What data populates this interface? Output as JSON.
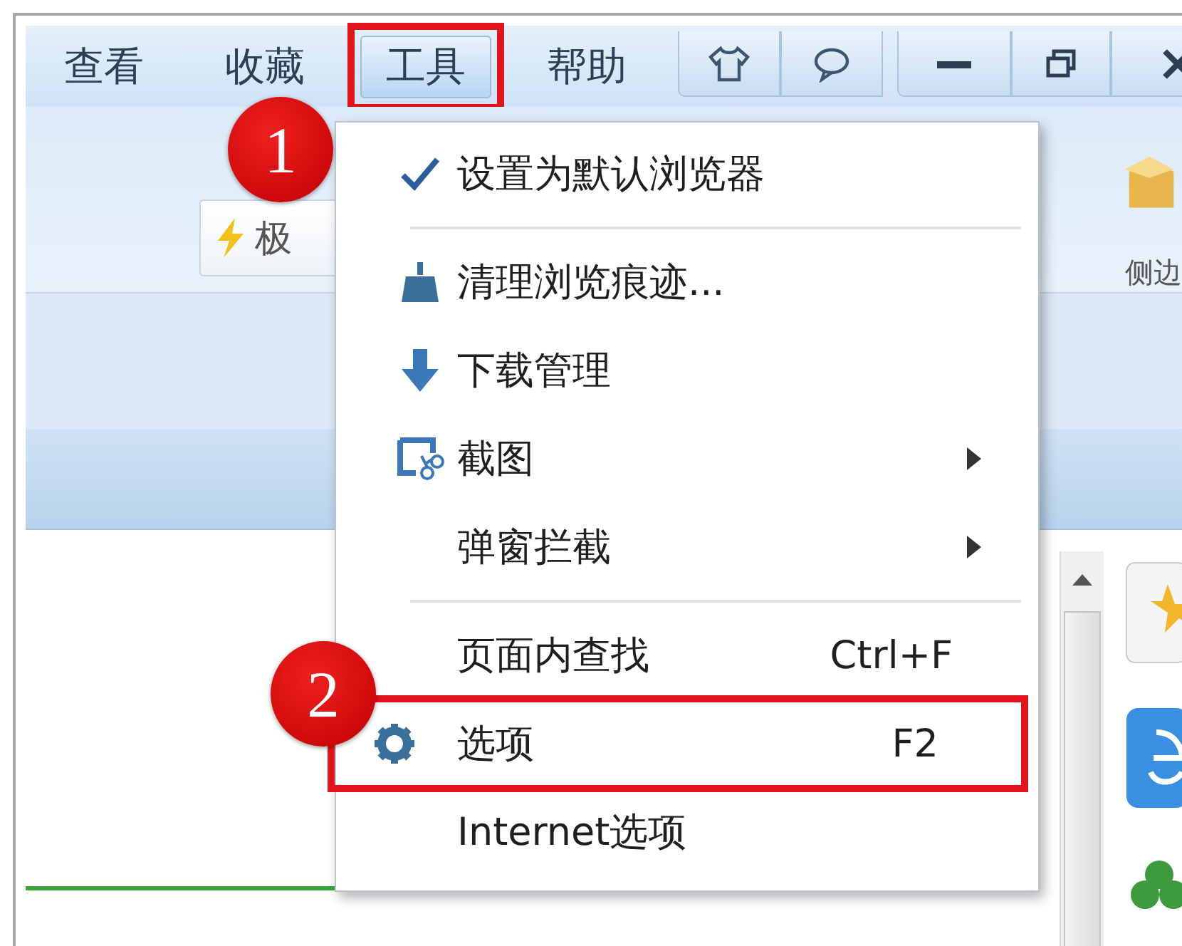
{
  "menu_bar": {
    "items": [
      {
        "label": "查看",
        "selected": false,
        "marked": false
      },
      {
        "label": "收藏",
        "selected": false,
        "marked": false
      },
      {
        "label": "工具",
        "selected": true,
        "marked": true
      },
      {
        "label": "帮助",
        "selected": false,
        "marked": false
      }
    ]
  },
  "toolbar": {
    "speed_button": "极",
    "side_label": "侧边"
  },
  "dropdown": {
    "items": [
      {
        "kind": "plain",
        "label": "设置为默认浏览器",
        "checked": true,
        "submenu": false,
        "marked": false
      },
      {
        "kind": "separator"
      },
      {
        "kind": "clean",
        "label": "清理浏览痕迹...",
        "checked": false,
        "submenu": false,
        "marked": false
      },
      {
        "kind": "download",
        "label": "下载管理",
        "checked": false,
        "submenu": false,
        "marked": false
      },
      {
        "kind": "capture",
        "label": "截图",
        "checked": false,
        "submenu": true,
        "marked": false
      },
      {
        "kind": "plain",
        "label": "弹窗拦截",
        "checked": false,
        "submenu": true,
        "marked": false
      },
      {
        "kind": "separator"
      },
      {
        "kind": "plain",
        "label": "页面内查找",
        "shortcut": "Ctrl+F",
        "checked": false,
        "submenu": false,
        "marked": false
      },
      {
        "kind": "settings",
        "label": "选项",
        "shortcut": "F2",
        "checked": false,
        "submenu": false,
        "marked": true
      },
      {
        "kind": "plain",
        "label": "Internet选项",
        "checked": false,
        "submenu": false,
        "marked": false
      }
    ]
  },
  "annotations": [
    {
      "number": "1"
    },
    {
      "number": "2"
    }
  ]
}
